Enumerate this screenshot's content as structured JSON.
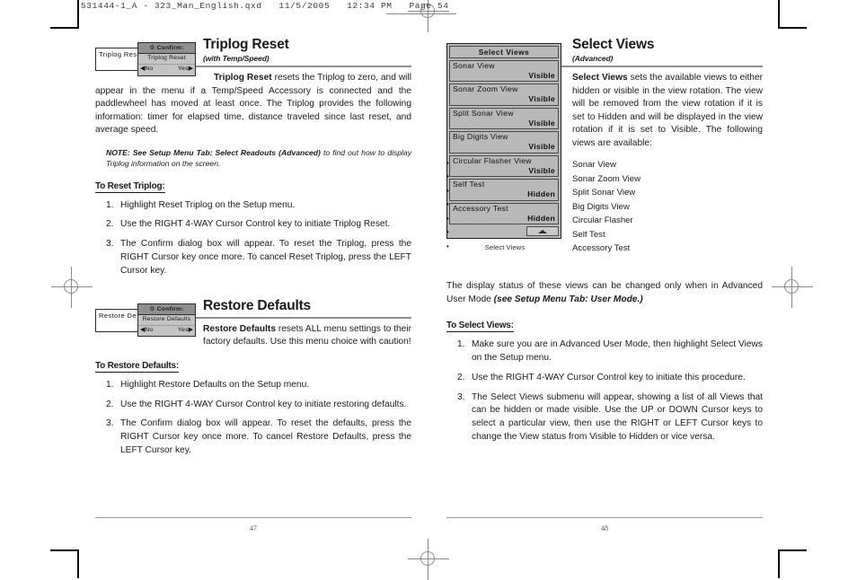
{
  "prepress": {
    "header": "531444-1_A - 323_Man_English.qxd   11/5/2005   12:34 PM   Page 54"
  },
  "left_page": {
    "folio": "47",
    "triplog": {
      "figure": {
        "menu_item_label": "Triplog Rese",
        "dialog": {
          "gear_icon": "⚙",
          "header": "Confirm:",
          "label": "Triplog Reset",
          "no_label": "◀No",
          "yes_label": "Yes▶"
        }
      },
      "title": "Triplog Reset",
      "subtitle": "(with Temp/Speed)",
      "body_lead": "Triplog Reset",
      "body_rest": " resets the Triplog to zero, and will appear in the menu if a Temp/Speed Accessory is connected and the paddlewheel has moved at least once. The Triplog provides the following information: timer for elapsed time, distance traveled since last reset, and average speed.",
      "note_lead": "NOTE:",
      "note_bold": "See Setup Menu Tab: Select Readouts (Advanced)",
      "note_rest": " to find out how to display Triplog information on the screen.",
      "procedure_title": "To Reset Triplog:",
      "steps": [
        "Highlight Reset Triplog on the Setup menu.",
        "Use the RIGHT 4-WAY Cursor Control key to initiate Triplog Reset.",
        "The Confirm dialog box will appear. To reset the Triplog, press the RIGHT Cursor key once more. To cancel Reset Triplog, press the LEFT Cursor key."
      ]
    },
    "restore": {
      "figure": {
        "menu_item_label": "Restore De",
        "dialog": {
          "gear_icon": "⚙",
          "header": "Confirm:",
          "label": "Restore Defaults",
          "no_label": "◀No",
          "yes_label": "Yes▶"
        }
      },
      "title": "Restore Defaults",
      "body_lead": "Restore Defaults",
      "body_rest": " resets ALL menu settings to their factory defaults. Use this menu choice with caution!",
      "procedure_title": "To Restore Defaults:",
      "steps": [
        "Highlight Restore Defaults on the Setup menu.",
        "Use the RIGHT 4-WAY Cursor Control key to initiate restoring defaults.",
        "The Confirm dialog box will appear. To reset the defaults,  press the RIGHT Cursor key once more. To cancel Restore Defaults, press the LEFT Cursor key."
      ]
    }
  },
  "right_page": {
    "folio": "48",
    "figure": {
      "lcd_title": "Select Views",
      "rows": [
        {
          "name": "Sonar View",
          "state": "Visible"
        },
        {
          "name": "Sonar Zoom View",
          "state": "Visible"
        },
        {
          "name": "Split Sonar View",
          "state": "Visible"
        },
        {
          "name": "Big Digits View",
          "state": "Visible"
        },
        {
          "name": "Circular Flasher View",
          "state": "Visible"
        },
        {
          "name": "Self Test",
          "state": "Hidden"
        },
        {
          "name": "Accessory Test",
          "state": "Hidden"
        }
      ],
      "caption": "Select Views"
    },
    "title": "Select Views",
    "subtitle": "(Advanced)",
    "body_lead": "Select Views",
    "body_rest": " sets the available views to either hidden or visible in the view rotation.  The view will be removed from the view rotation if it is set to Hidden and will be displayed in the view rotation if it is set to Visible. The following views are available:",
    "view_list": [
      "Sonar View",
      "Sonar Zoom View",
      "Split Sonar View",
      "Big Digits View",
      "Circular Flasher",
      "Self Test",
      "Accessory Test"
    ],
    "status_text": "The display status of these views can be changed only when in Advanced User Mode ",
    "status_bold": "(see Setup Menu Tab: User Mode.)",
    "procedure_title": "To Select Views:",
    "steps": [
      "Make sure you are in Advanced User Mode, then highlight Select Views on the Setup menu.",
      "Use the RIGHT 4-WAY Cursor Control key to initiate this procedure.",
      "The Select Views submenu will appear, showing a list of all Views that can be hidden or made visible. Use the UP or DOWN Cursor keys to select a particular view, then use the RIGHT or LEFT Cursor keys to change the View status from Visible to Hidden or vice versa."
    ]
  }
}
